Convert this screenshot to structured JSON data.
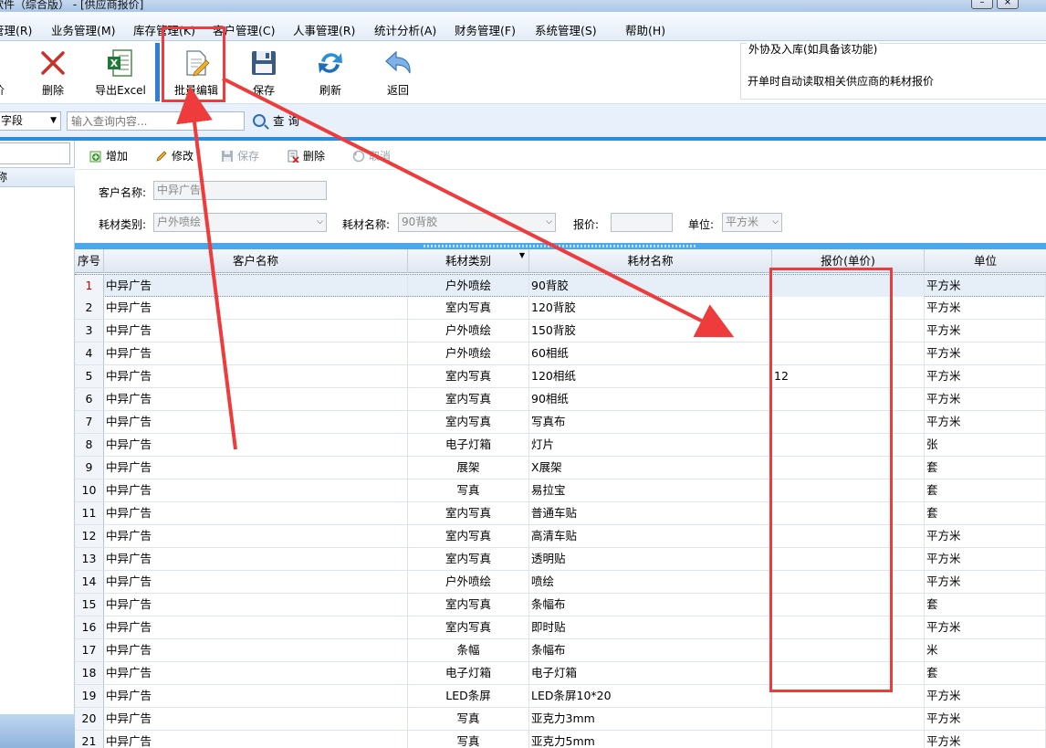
{
  "window": {
    "title": "软件（综合版） - [供应商报价]",
    "minimize": "–",
    "close": "×"
  },
  "menu": {
    "items": [
      "管理(R)",
      "业务管理(M)",
      "库存管理(K)",
      "客户管理(C)",
      "人事管理(R)",
      "统计分析(A)",
      "财务管理(F)",
      "系统管理(S)",
      "帮助(H)"
    ]
  },
  "toolbar": {
    "cut_label": "价",
    "delete_label": "删除",
    "export_label": "导出Excel",
    "batch_edit_label": "批量编辑",
    "save_label": "保存",
    "refresh_label": "刷新",
    "back_label": "返回"
  },
  "info": {
    "legend": "外协及入库(如具备该功能)",
    "text": "开单时自动读取相关供应商的耗材报价"
  },
  "search": {
    "field_value": "字段",
    "placeholder": "输入查询内容...",
    "query_label": "查 询"
  },
  "left": {
    "header": "称"
  },
  "subtoolbar": {
    "add": "增加",
    "edit": "修改",
    "save": "保存",
    "delete": "删除",
    "cancel": "取消"
  },
  "form": {
    "customer_label": "客户名称:",
    "customer_value": "中异广告",
    "category_label": "耗材类别:",
    "category_value": "户外喷绘",
    "material_label": "耗材名称:",
    "material_value": "90背胶",
    "price_label": "报价:",
    "price_value": "",
    "unit_label": "单位:",
    "unit_value": "平方米"
  },
  "grid": {
    "headers": {
      "no": "序号",
      "customer": "客户名称",
      "category": "耗材类别",
      "material": "耗材名称",
      "price": "报价(单价)",
      "unit": "单位"
    },
    "rows": [
      {
        "no": "1",
        "customer": "中异广告",
        "category": "户外喷绘",
        "material": "90背胶",
        "price": "",
        "unit": "平方米"
      },
      {
        "no": "2",
        "customer": "中异广告",
        "category": "室内写真",
        "material": "120背胶",
        "price": "",
        "unit": "平方米"
      },
      {
        "no": "3",
        "customer": "中异广告",
        "category": "户外喷绘",
        "material": "150背胶",
        "price": "",
        "unit": "平方米"
      },
      {
        "no": "4",
        "customer": "中异广告",
        "category": "户外喷绘",
        "material": "60相纸",
        "price": "",
        "unit": "平方米"
      },
      {
        "no": "5",
        "customer": "中异广告",
        "category": "室内写真",
        "material": "120相纸",
        "price": "12",
        "unit": "平方米"
      },
      {
        "no": "6",
        "customer": "中异广告",
        "category": "室内写真",
        "material": "90相纸",
        "price": "",
        "unit": "平方米"
      },
      {
        "no": "7",
        "customer": "中异广告",
        "category": "室内写真",
        "material": "写真布",
        "price": "",
        "unit": "平方米"
      },
      {
        "no": "8",
        "customer": "中异广告",
        "category": "电子灯箱",
        "material": "灯片",
        "price": "",
        "unit": "张"
      },
      {
        "no": "9",
        "customer": "中异广告",
        "category": "展架",
        "material": "X展架",
        "price": "",
        "unit": "套"
      },
      {
        "no": "10",
        "customer": "中异广告",
        "category": "写真",
        "material": "易拉宝",
        "price": "",
        "unit": "套"
      },
      {
        "no": "11",
        "customer": "中异广告",
        "category": "室内写真",
        "material": "普通车贴",
        "price": "",
        "unit": "套"
      },
      {
        "no": "12",
        "customer": "中异广告",
        "category": "室内写真",
        "material": "高清车贴",
        "price": "",
        "unit": "平方米"
      },
      {
        "no": "13",
        "customer": "中异广告",
        "category": "室内写真",
        "material": "透明贴",
        "price": "",
        "unit": "平方米"
      },
      {
        "no": "14",
        "customer": "中异广告",
        "category": "户外喷绘",
        "material": "喷绘",
        "price": "",
        "unit": "平方米"
      },
      {
        "no": "15",
        "customer": "中异广告",
        "category": "室内写真",
        "material": "条幅布",
        "price": "",
        "unit": "套"
      },
      {
        "no": "16",
        "customer": "中异广告",
        "category": "室内写真",
        "material": "即时贴",
        "price": "",
        "unit": "平方米"
      },
      {
        "no": "17",
        "customer": "中异广告",
        "category": "条幅",
        "material": "条幅布",
        "price": "",
        "unit": "米"
      },
      {
        "no": "18",
        "customer": "中异广告",
        "category": "电子灯箱",
        "material": "电子灯箱",
        "price": "",
        "unit": "套"
      },
      {
        "no": "19",
        "customer": "中异广告",
        "category": "LED条屏",
        "material": "LED条屏10*20",
        "price": "",
        "unit": "平方米"
      },
      {
        "no": "20",
        "customer": "中异广告",
        "category": "写真",
        "material": "亚克力3mm",
        "price": "",
        "unit": "平方米"
      },
      {
        "no": "21",
        "customer": "中异广告",
        "category": "写真",
        "material": "亚克力5mm",
        "price": "",
        "unit": "平方米"
      }
    ]
  },
  "colors": {
    "accent_blue": "#2a8de0",
    "annotation_red": "#ee3b3b",
    "selected_row": "#e6eef8"
  }
}
